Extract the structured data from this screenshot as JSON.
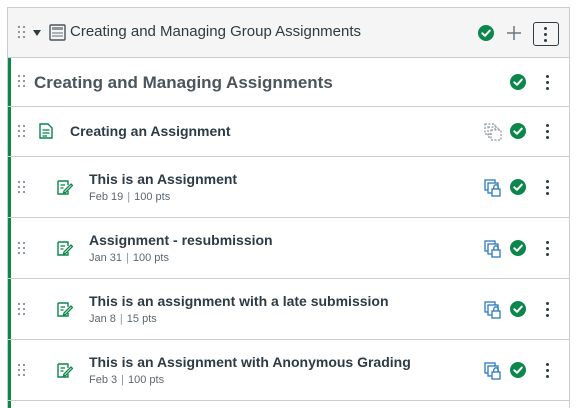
{
  "module": {
    "title": "Creating and Managing Group Assignments",
    "icons": [
      "drag-handle-icon",
      "caret-down-icon",
      "module-icon",
      "published-check-icon",
      "plus-icon",
      "kebab-menu-icon"
    ]
  },
  "items": [
    {
      "kind": "subheader",
      "title": "Creating and Managing Assignments"
    },
    {
      "kind": "page",
      "title": "Creating an Assignment"
    },
    {
      "kind": "assignment",
      "title": "This is an Assignment",
      "date": "Feb 19",
      "points": "100 pts"
    },
    {
      "kind": "assignment",
      "title": "Assignment - resubmission",
      "date": "Jan 31",
      "points": "100 pts"
    },
    {
      "kind": "assignment",
      "title": "This is an assignment with a late submission",
      "date": "Jan 8",
      "points": "15 pts"
    },
    {
      "kind": "assignment",
      "title": "This is an Assignment with Anonymous Grading",
      "date": "Feb 3",
      "points": "100 pts"
    }
  ],
  "colors": {
    "published_green": "#0b874b",
    "assignment_icon_green": "#0b874b",
    "blueprint_lock_blue": "#2b7abc",
    "text": "#2d3b45",
    "border": "#c7cdd1"
  }
}
